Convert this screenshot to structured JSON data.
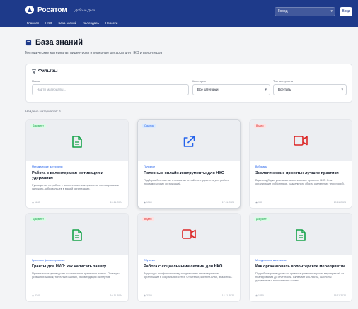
{
  "header": {
    "logo": "Росатом",
    "logo_sub": "Добрые Дела",
    "city_placeholder": "Город",
    "login": "Вход",
    "nav": [
      "Главная",
      "НКО",
      "База знаний",
      "Календарь",
      "Новости"
    ]
  },
  "page": {
    "title": "База знаний",
    "subtitle": "Методические материалы, видеоуроки и полезные ресурсы для НКО и волонтеров"
  },
  "filters": {
    "title": "Фильтры",
    "search_label": "Поиск",
    "search_placeholder": "Найти материалы...",
    "category_label": "Категория",
    "category_value": "Все категории",
    "type_label": "Тип материала",
    "type_value": "Все типы"
  },
  "found": "Найдено материалов: 6",
  "colors": {
    "header": "#1e3a8a",
    "document": "#16a34a",
    "link": "#2563eb",
    "video": "#dc2626"
  },
  "cards": [
    {
      "badge": "Документ",
      "type": "document",
      "icon": "document-icon",
      "category": "Методические материалы",
      "title": "Работа с волонтерами: мотивация и удержание",
      "desc": "Руководство по работе с волонтерами: как привлечь, мотивировать и удержать добровольцев в вашей организации.",
      "views": "1245",
      "date": "15.11.2024"
    },
    {
      "badge": "Ссылка",
      "type": "link",
      "icon": "external-link-icon",
      "category": "Полезное",
      "title": "Полезные онлайн-инструменты для НКО",
      "desc": "Подборка бесплатных и полезных онлайн-инструментов для работы некоммерческих организаций.",
      "views": "1560",
      "date": "17.11.2024"
    },
    {
      "badge": "Видео",
      "type": "video",
      "icon": "video-camera-icon",
      "category": "Вебинары",
      "title": "Экологические проекты: лучшие практики",
      "desc": "Видеоподборка успешных экологических проектов НКО. Опыт организации субботников, раздельного сбора, озеленения территорий.",
      "views": "980",
      "date": "19.11.2024"
    },
    {
      "badge": "Документ",
      "type": "document",
      "icon": "document-icon",
      "category": "Грантовое финансирование",
      "title": "Гранты для НКО: как написать заявку",
      "desc": "Практическое руководство по написанию грантовых заявок. Примеры успешных заявок, типичные ошибки, рекомендации экспертов.",
      "views": "2340",
      "date": "10.11.2024"
    },
    {
      "badge": "Видео",
      "type": "video",
      "icon": "video-camera-icon",
      "category": "Обучение",
      "title": "Работа с социальными сетями для НКО",
      "desc": "Видеокурс по эффективному продвижению некоммерческих организаций в социальных сетях. Стратегии, контент-план, аналитика.",
      "views": "2100",
      "date": "14.11.2024"
    },
    {
      "badge": "Документ",
      "type": "document",
      "icon": "document-icon",
      "category": "Методические материалы",
      "title": "Как организовать волонтерское мероприятие",
      "desc": "Подробное руководство по организации волонтерских мероприятий от планирования до отчетности. Включает чек-листы, шаблоны документов и практические советы.",
      "views": "1250",
      "date": "16.11.2024"
    }
  ]
}
